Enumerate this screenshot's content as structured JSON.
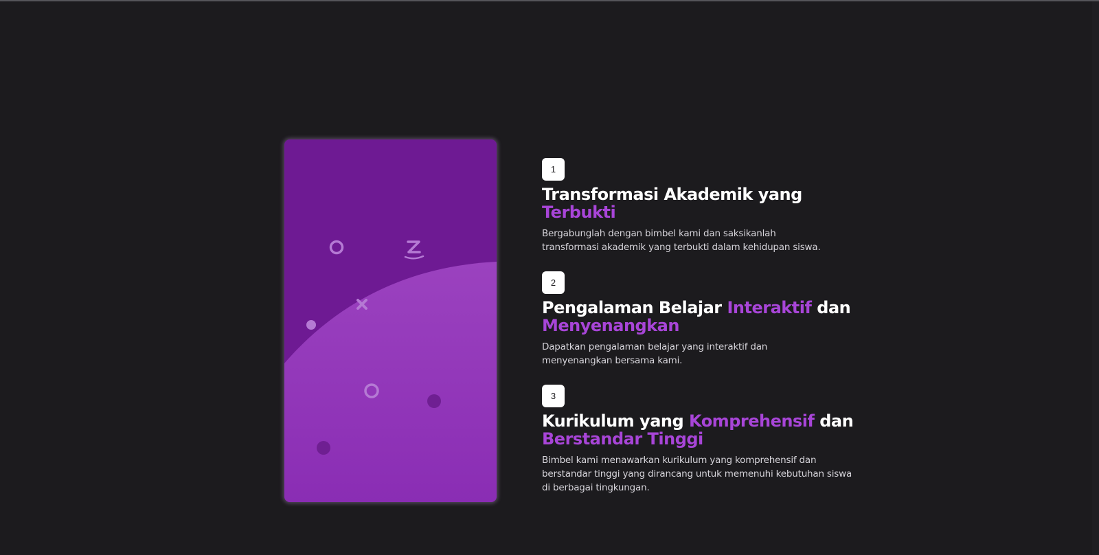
{
  "colors": {
    "background": "#1c1b1e",
    "accent": "#a845d8",
    "card_dark": "#6e1a93",
    "card_light": "#9a3fc0",
    "badge_bg": "#ffffff",
    "text": "#ffffff",
    "muted_text": "#d6d4da"
  },
  "illustration": {
    "shapes": [
      "circle-outline-icon",
      "z-letter-icon",
      "x-cross-icon",
      "dot-icon",
      "circle-outline-icon",
      "dot-icon",
      "dot-icon"
    ]
  },
  "features": [
    {
      "number": "1",
      "title_parts": [
        {
          "text": "Transformasi Akademik yang ",
          "accent": false
        },
        {
          "text": "Terbukti",
          "accent": true
        }
      ],
      "description": "Bergabunglah dengan bimbel kami dan saksikanlah transformasi akademik yang terbukti dalam kehidupan siswa."
    },
    {
      "number": "2",
      "title_parts": [
        {
          "text": "Pengalaman Belajar ",
          "accent": false
        },
        {
          "text": "Interaktif",
          "accent": true
        },
        {
          "text": " dan ",
          "accent": false
        },
        {
          "text": "Menyenangkan",
          "accent": true
        }
      ],
      "description": "Dapatkan pengalaman belajar yang interaktif dan menyenangkan bersama kami."
    },
    {
      "number": "3",
      "title_parts": [
        {
          "text": "Kurikulum yang ",
          "accent": false
        },
        {
          "text": "Komprehensif",
          "accent": true
        },
        {
          "text": " dan ",
          "accent": false
        },
        {
          "text": "Berstandar Tinggi",
          "accent": true
        }
      ],
      "description": "Bimbel kami menawarkan kurikulum yang komprehensif dan berstandar tinggi yang dirancang untuk memenuhi kebutuhan siswa di berbagai tingkungan."
    }
  ]
}
